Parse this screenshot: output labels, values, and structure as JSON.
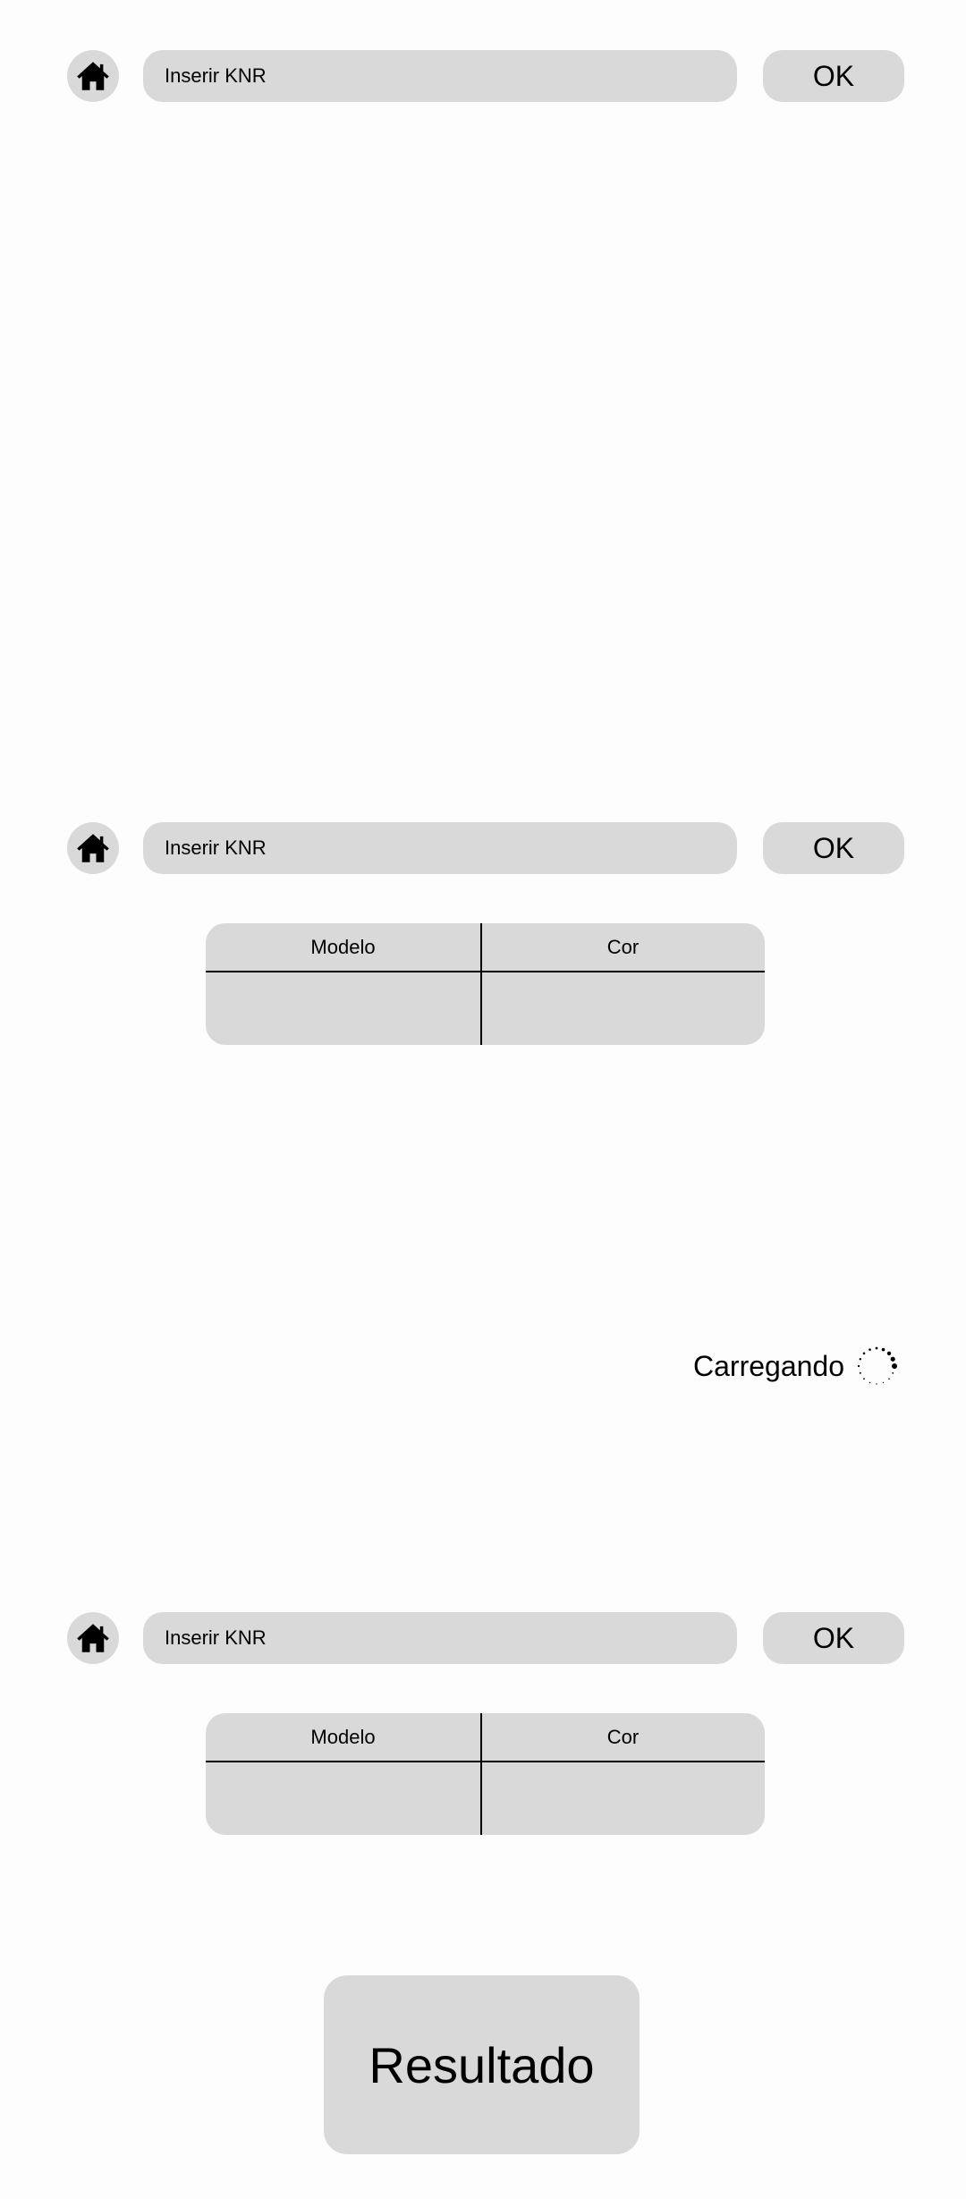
{
  "screens": [
    {
      "search": {
        "placeholder": "Inserir KNR"
      },
      "ok_label": "OK"
    },
    {
      "search": {
        "placeholder": "Inserir KNR"
      },
      "ok_label": "OK",
      "table": {
        "headers": [
          "Modelo",
          "Cor"
        ],
        "row": [
          "",
          ""
        ]
      },
      "loading_text": "Carregando"
    },
    {
      "search": {
        "placeholder": "Inserir KNR"
      },
      "ok_label": "OK",
      "table": {
        "headers": [
          "Modelo",
          "Cor"
        ],
        "row": [
          "",
          ""
        ]
      },
      "result_label": "Resultado"
    }
  ],
  "icons": {
    "home": "home-icon",
    "loading": "loading-spinner-icon"
  },
  "colors": {
    "background": "#fdfdfd",
    "control": "#d9d9d9",
    "text": "#000000"
  }
}
